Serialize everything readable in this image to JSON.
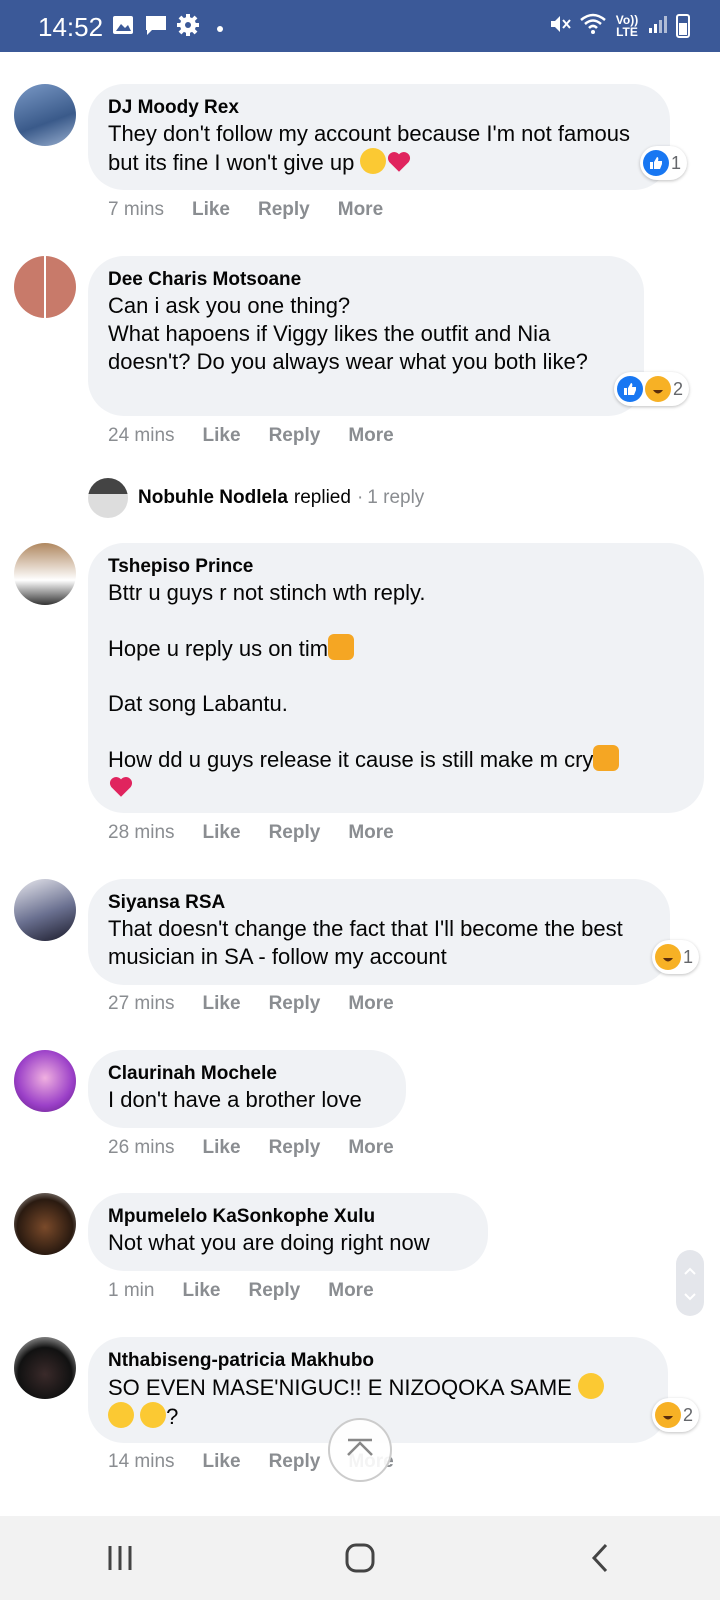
{
  "status_bar": {
    "time": "14:52",
    "network_label": "Vo)) LTE"
  },
  "comments": [
    {
      "author": "DJ Moody Rex",
      "text": "They don't follow my account because I'm not famous but its fine I won't give up",
      "time": "7 mins",
      "reactions_count": "1"
    },
    {
      "author": "Dee Charis Motsoane",
      "text": "Can i ask you one thing?\nWhat hapoens if Viggy likes the outfit and Nia doesn't? Do you always wear what you both like?",
      "time": "24 mins",
      "reactions_count": "2"
    },
    {
      "author": "Tshepiso Prince",
      "text_1": "Bttr u guys r not stinch wth reply.",
      "text_2": "Hope u reply us on tim",
      "text_3": "Dat song Labantu.",
      "text_4": "How dd u guys release it cause is still make m cry",
      "time": "28 mins"
    },
    {
      "author": "Siyansa RSA",
      "text": "That doesn't change the fact that I'll become the best musician in SA - follow my account",
      "time": "27 mins",
      "reactions_count": "1"
    },
    {
      "author": "Claurinah Mochele",
      "text": "I don't have a brother love",
      "time": "26 mins"
    },
    {
      "author": "Mpumelelo KaSonkophe Xulu",
      "text": "Not what you are doing right now",
      "time": "1 min"
    },
    {
      "author": "Nthabiseng-patricia Makhubo",
      "text_1": "SO EVEN MASE'NIGUC!! E NIZOQOKA SAME",
      "text_2": "?",
      "time": "14 mins",
      "reactions_count": "2"
    }
  ],
  "reply_summary": {
    "name": "Nobuhle Nodlela",
    "verb": "replied",
    "separator": "·",
    "count": "1 reply"
  },
  "actions": {
    "like": "Like",
    "reply": "Reply",
    "more": "More"
  },
  "colors": {
    "status_bar": "#3b5998",
    "bubble": "#f0f2f5",
    "like_blue": "#1877f2",
    "muted": "#8a8d91"
  }
}
